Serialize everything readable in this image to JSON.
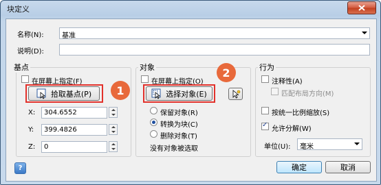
{
  "window": {
    "title": "块定义"
  },
  "name": {
    "label": "名称(N):",
    "value": "基准"
  },
  "description": {
    "label": "说明(D):",
    "value": ""
  },
  "basepoint": {
    "group_label": "基点",
    "specify_on_screen": "在屏幕上指定(F)",
    "pick_button": "拾取基点(P)",
    "badge": "1",
    "x_label": "X:",
    "x_value": "304.6552",
    "y_label": "Y:",
    "y_value": "399.4826",
    "z_label": "Z:",
    "z_value": "0"
  },
  "objects": {
    "group_label": "对象",
    "specify_on_screen": "在屏幕上指定(O)",
    "select_button": "选择对象(E)",
    "badge": "2",
    "retain": "保留对象(R)",
    "convert": "转换为块(C)",
    "delete": "删除对象(T)",
    "status": "没有对象被选取",
    "selected_option": "convert"
  },
  "behavior": {
    "group_label": "行为",
    "annotative": "注释性(A)",
    "match_orientation": "匹配布局方向(M)",
    "scale_uniformly": "按统一比例缩放(S)",
    "allow_exploding": "允许分解(W)",
    "allow_exploding_checked": true,
    "units_label": "单位(U):",
    "units_value": "毫米"
  },
  "footer": {
    "ok": "确定",
    "cancel": "取消"
  },
  "colors": {
    "highlight": "#e2312b",
    "badge": "#e8693b"
  }
}
